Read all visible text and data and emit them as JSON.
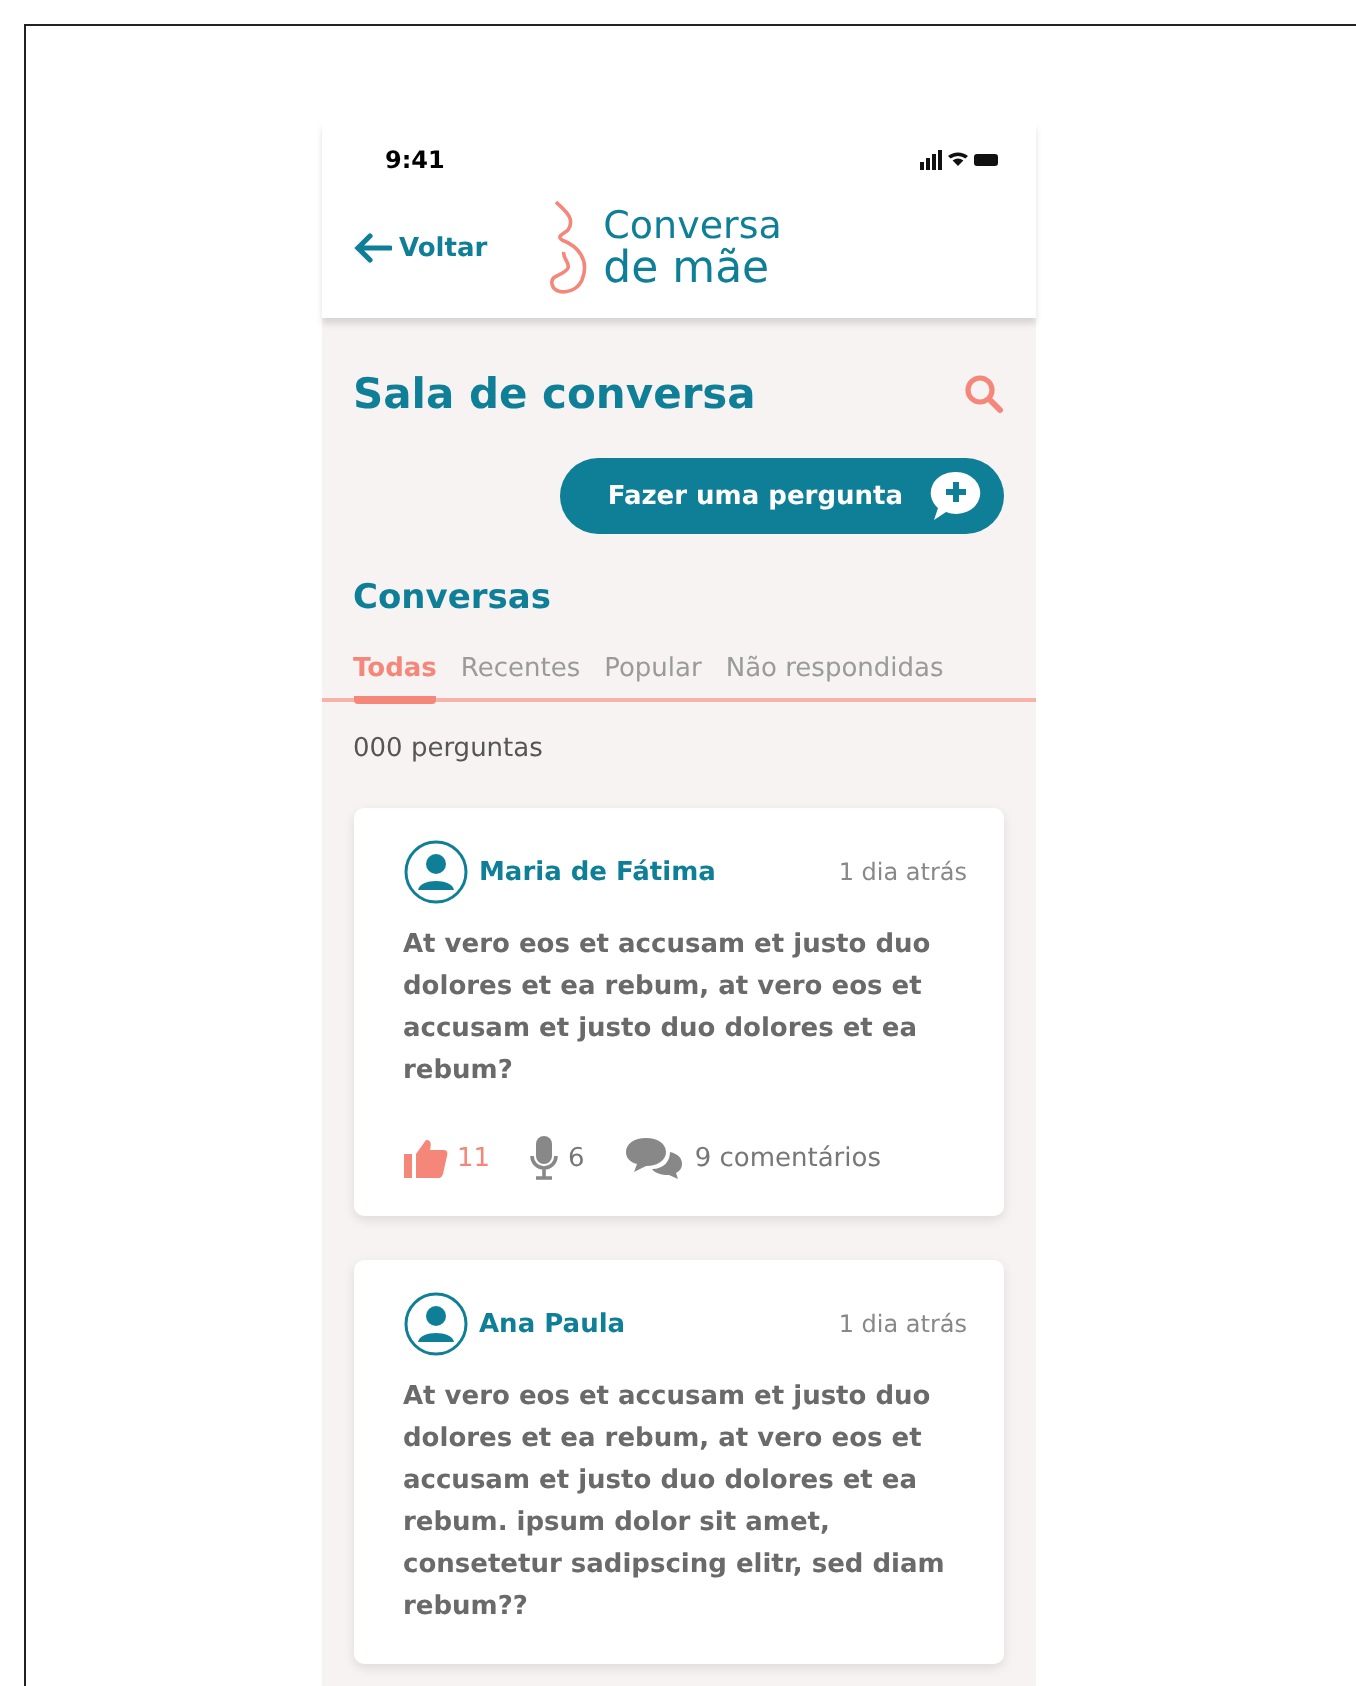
{
  "status_bar": {
    "time": "9:41"
  },
  "header": {
    "back_label": "Voltar",
    "logo_line_1": "Conversa",
    "logo_line_2": "de mãe"
  },
  "page_title": "Sala de conversa",
  "ask_button": "Fazer uma pergunta",
  "section_title": "Conversas",
  "tabs": [
    {
      "label": "Todas",
      "selected": true
    },
    {
      "label": "Recentes",
      "selected": false
    },
    {
      "label": "Popular",
      "selected": false
    },
    {
      "label": "Não respondidas",
      "selected": false
    }
  ],
  "count": "000 perguntas",
  "posts": [
    {
      "author": "Maria de Fátima",
      "time": "1 dia atrás",
      "text": "At vero eos et accusam et justo duo dolores et ea rebum, at vero eos et accusam et justo duo dolores et ea rebum?",
      "likes": "11",
      "liked": true,
      "audios": "6",
      "comments": "9 comentários"
    },
    {
      "author": "Ana Paula",
      "time": "1 dia atrás",
      "text": "At vero eos et accusam et justo duo dolores et ea rebum, at vero eos et accusam et justo duo dolores et ea rebum. ipsum dolor sit amet, consetetur sadipscing elitr, sed diam rebum??"
    }
  ]
}
